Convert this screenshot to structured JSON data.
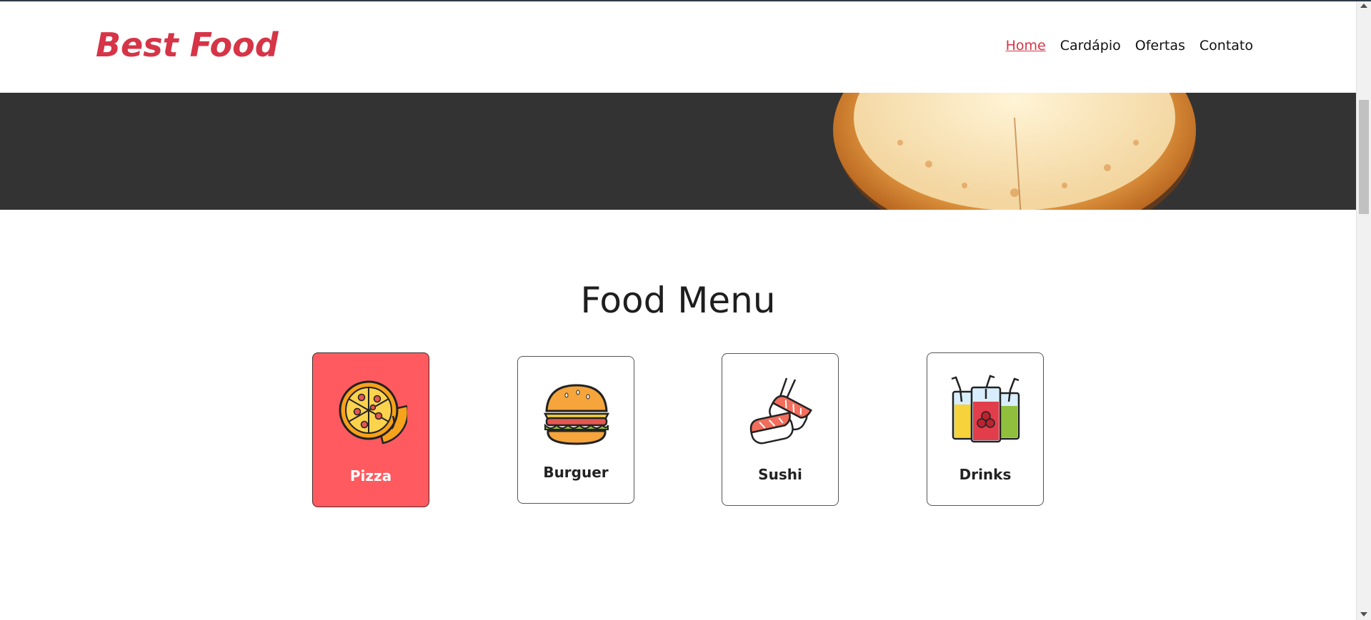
{
  "header": {
    "logo": "Best Food",
    "nav": [
      {
        "label": "Home",
        "active": true
      },
      {
        "label": "Cardápio",
        "active": false
      },
      {
        "label": "Ofertas",
        "active": false
      },
      {
        "label": "Contato",
        "active": false
      }
    ]
  },
  "menu": {
    "title": "Food Menu",
    "categories": [
      {
        "label": "Pizza",
        "icon": "pizza-icon",
        "selected": true
      },
      {
        "label": "Burguer",
        "icon": "burger-icon",
        "selected": false
      },
      {
        "label": "Sushi",
        "icon": "sushi-icon",
        "selected": false
      },
      {
        "label": "Drinks",
        "icon": "drinks-icon",
        "selected": false
      }
    ]
  },
  "colors": {
    "brand": "#d63447",
    "selected_card": "#ff5a5f",
    "hero_background": "#333333"
  }
}
